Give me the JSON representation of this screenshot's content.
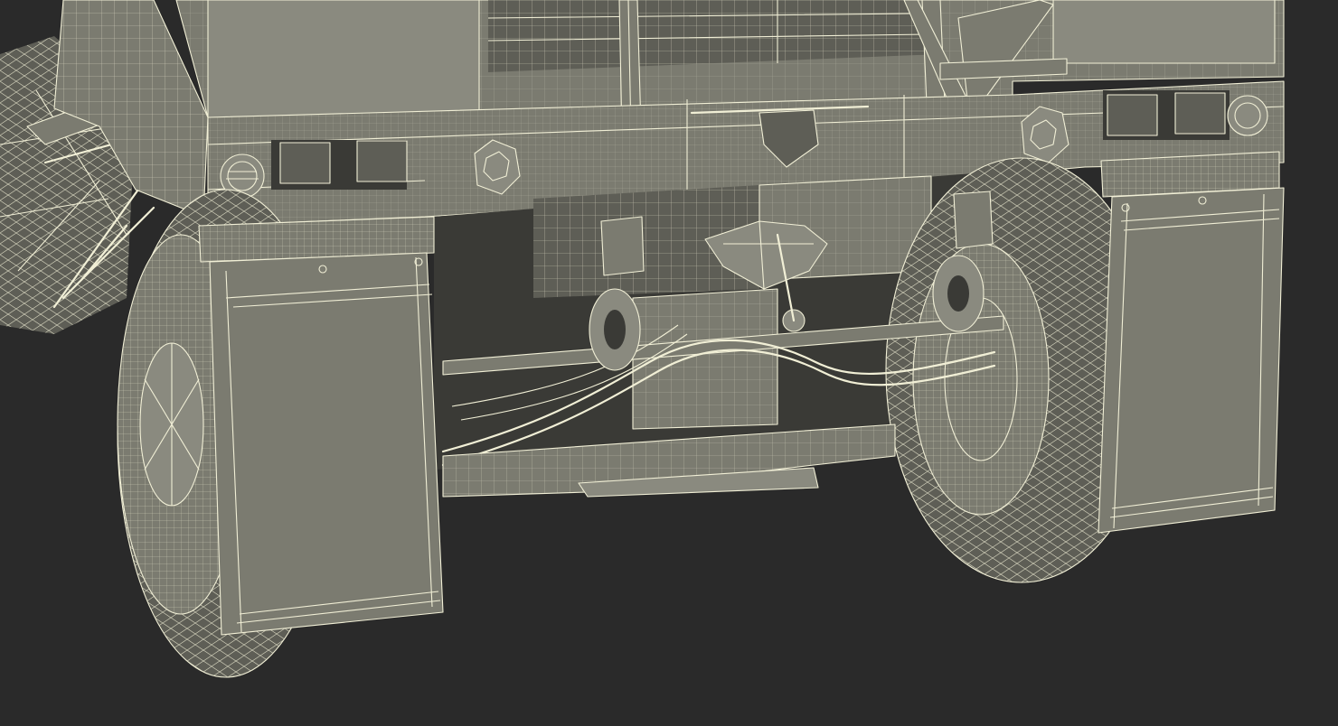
{
  "scene": {
    "background": "#2a2a2a",
    "mesh_fill": "#7b7b70",
    "mesh_fill_dark": "#5e5e56",
    "mesh_fill_light": "#8a8a7f",
    "shadow_fill": "#3a3a36",
    "wire_color": "#f1efd6"
  }
}
